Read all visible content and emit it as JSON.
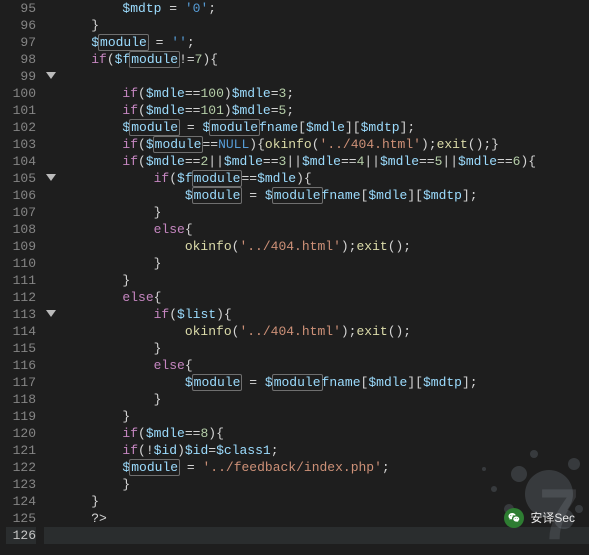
{
  "line_start": 95,
  "line_end": 126,
  "current_line": 126,
  "fold_lines": [
    99,
    105,
    113
  ],
  "highlight_word": "module",
  "lines": [
    {
      "n": 95,
      "indent": 8,
      "tokens": [
        {
          "t": "var",
          "v": "$mdtp"
        },
        {
          "t": "punc",
          "v": " "
        },
        {
          "t": "op",
          "v": "="
        },
        {
          "t": "punc",
          "v": " "
        },
        {
          "t": "dstr",
          "v": "'0'"
        },
        {
          "t": "punc",
          "v": ";"
        }
      ]
    },
    {
      "n": 96,
      "indent": 4,
      "tokens": [
        {
          "t": "punc",
          "v": "}"
        }
      ]
    },
    {
      "n": 97,
      "indent": 4,
      "tokens": [
        {
          "t": "var",
          "v": "$"
        },
        {
          "t": "var-hl",
          "v": "module"
        },
        {
          "t": "punc",
          "v": " "
        },
        {
          "t": "op",
          "v": "="
        },
        {
          "t": "punc",
          "v": " "
        },
        {
          "t": "dstr",
          "v": "''"
        },
        {
          "t": "punc",
          "v": ";"
        }
      ]
    },
    {
      "n": 98,
      "indent": 4,
      "tokens": [
        {
          "t": "kw",
          "v": "if"
        },
        {
          "t": "punc",
          "v": "("
        },
        {
          "t": "var",
          "v": "$f"
        },
        {
          "t": "var-hl",
          "v": "module"
        },
        {
          "t": "op",
          "v": "!="
        },
        {
          "t": "num",
          "v": "7"
        },
        {
          "t": "punc",
          "v": "){"
        }
      ]
    },
    {
      "n": 99,
      "indent": 0,
      "tokens": []
    },
    {
      "n": 100,
      "indent": 8,
      "tokens": [
        {
          "t": "kw",
          "v": "if"
        },
        {
          "t": "punc",
          "v": "("
        },
        {
          "t": "var",
          "v": "$mdle"
        },
        {
          "t": "op",
          "v": "=="
        },
        {
          "t": "num",
          "v": "100"
        },
        {
          "t": "punc",
          "v": ")"
        },
        {
          "t": "var",
          "v": "$mdle"
        },
        {
          "t": "op",
          "v": "="
        },
        {
          "t": "num",
          "v": "3"
        },
        {
          "t": "punc",
          "v": ";"
        }
      ]
    },
    {
      "n": 101,
      "indent": 8,
      "tokens": [
        {
          "t": "kw",
          "v": "if"
        },
        {
          "t": "punc",
          "v": "("
        },
        {
          "t": "var",
          "v": "$mdle"
        },
        {
          "t": "op",
          "v": "=="
        },
        {
          "t": "num",
          "v": "101"
        },
        {
          "t": "punc",
          "v": ")"
        },
        {
          "t": "var",
          "v": "$mdle"
        },
        {
          "t": "op",
          "v": "="
        },
        {
          "t": "num",
          "v": "5"
        },
        {
          "t": "punc",
          "v": ";"
        }
      ]
    },
    {
      "n": 102,
      "indent": 8,
      "tokens": [
        {
          "t": "var",
          "v": "$"
        },
        {
          "t": "var-hl",
          "v": "module"
        },
        {
          "t": "punc",
          "v": " "
        },
        {
          "t": "op",
          "v": "="
        },
        {
          "t": "punc",
          "v": " "
        },
        {
          "t": "var",
          "v": "$"
        },
        {
          "t": "var-hl",
          "v": "module"
        },
        {
          "t": "var",
          "v": "fname"
        },
        {
          "t": "punc",
          "v": "["
        },
        {
          "t": "var",
          "v": "$mdle"
        },
        {
          "t": "punc",
          "v": "]["
        },
        {
          "t": "var",
          "v": "$mdtp"
        },
        {
          "t": "punc",
          "v": "];"
        }
      ]
    },
    {
      "n": 103,
      "indent": 8,
      "tokens": [
        {
          "t": "kw",
          "v": "if"
        },
        {
          "t": "punc",
          "v": "("
        },
        {
          "t": "var",
          "v": "$"
        },
        {
          "t": "var-hl",
          "v": "module"
        },
        {
          "t": "op",
          "v": "=="
        },
        {
          "t": "const",
          "v": "NULL"
        },
        {
          "t": "punc",
          "v": "){"
        },
        {
          "t": "fn",
          "v": "okinfo"
        },
        {
          "t": "punc",
          "v": "("
        },
        {
          "t": "str",
          "v": "'../404.html'"
        },
        {
          "t": "punc",
          "v": ");"
        },
        {
          "t": "fn",
          "v": "exit"
        },
        {
          "t": "punc",
          "v": "();}"
        }
      ]
    },
    {
      "n": 104,
      "indent": 8,
      "tokens": [
        {
          "t": "kw",
          "v": "if"
        },
        {
          "t": "punc",
          "v": "("
        },
        {
          "t": "var",
          "v": "$mdle"
        },
        {
          "t": "op",
          "v": "=="
        },
        {
          "t": "num",
          "v": "2"
        },
        {
          "t": "op",
          "v": "||"
        },
        {
          "t": "var",
          "v": "$mdle"
        },
        {
          "t": "op",
          "v": "=="
        },
        {
          "t": "num",
          "v": "3"
        },
        {
          "t": "op",
          "v": "||"
        },
        {
          "t": "var",
          "v": "$mdle"
        },
        {
          "t": "op",
          "v": "=="
        },
        {
          "t": "num",
          "v": "4"
        },
        {
          "t": "op",
          "v": "||"
        },
        {
          "t": "var",
          "v": "$mdle"
        },
        {
          "t": "op",
          "v": "=="
        },
        {
          "t": "num",
          "v": "5"
        },
        {
          "t": "op",
          "v": "||"
        },
        {
          "t": "var",
          "v": "$mdle"
        },
        {
          "t": "op",
          "v": "=="
        },
        {
          "t": "num",
          "v": "6"
        },
        {
          "t": "punc",
          "v": "){"
        }
      ]
    },
    {
      "n": 105,
      "indent": 12,
      "tokens": [
        {
          "t": "kw",
          "v": "if"
        },
        {
          "t": "punc",
          "v": "("
        },
        {
          "t": "var",
          "v": "$f"
        },
        {
          "t": "var-hl",
          "v": "module"
        },
        {
          "t": "op",
          "v": "=="
        },
        {
          "t": "var",
          "v": "$mdle"
        },
        {
          "t": "punc",
          "v": "){"
        }
      ]
    },
    {
      "n": 106,
      "indent": 16,
      "tokens": [
        {
          "t": "var",
          "v": "$"
        },
        {
          "t": "var-hl",
          "v": "module"
        },
        {
          "t": "punc",
          "v": " "
        },
        {
          "t": "op",
          "v": "="
        },
        {
          "t": "punc",
          "v": " "
        },
        {
          "t": "var",
          "v": "$"
        },
        {
          "t": "var-hl",
          "v": "module"
        },
        {
          "t": "var",
          "v": "fname"
        },
        {
          "t": "punc",
          "v": "["
        },
        {
          "t": "var",
          "v": "$mdle"
        },
        {
          "t": "punc",
          "v": "]["
        },
        {
          "t": "var",
          "v": "$mdtp"
        },
        {
          "t": "punc",
          "v": "];"
        }
      ]
    },
    {
      "n": 107,
      "indent": 12,
      "tokens": [
        {
          "t": "punc",
          "v": "}"
        }
      ]
    },
    {
      "n": 108,
      "indent": 12,
      "tokens": [
        {
          "t": "kw",
          "v": "else"
        },
        {
          "t": "punc",
          "v": "{"
        }
      ]
    },
    {
      "n": 109,
      "indent": 16,
      "tokens": [
        {
          "t": "fn",
          "v": "okinfo"
        },
        {
          "t": "punc",
          "v": "("
        },
        {
          "t": "str",
          "v": "'../404.html'"
        },
        {
          "t": "punc",
          "v": ");"
        },
        {
          "t": "fn",
          "v": "exit"
        },
        {
          "t": "punc",
          "v": "();"
        }
      ]
    },
    {
      "n": 110,
      "indent": 12,
      "tokens": [
        {
          "t": "punc",
          "v": "}"
        }
      ]
    },
    {
      "n": 111,
      "indent": 8,
      "tokens": [
        {
          "t": "punc",
          "v": "}"
        }
      ]
    },
    {
      "n": 112,
      "indent": 8,
      "tokens": [
        {
          "t": "kw",
          "v": "else"
        },
        {
          "t": "punc",
          "v": "{"
        }
      ]
    },
    {
      "n": 113,
      "indent": 12,
      "tokens": [
        {
          "t": "kw",
          "v": "if"
        },
        {
          "t": "punc",
          "v": "("
        },
        {
          "t": "var",
          "v": "$list"
        },
        {
          "t": "punc",
          "v": "){"
        }
      ]
    },
    {
      "n": 114,
      "indent": 16,
      "tokens": [
        {
          "t": "fn",
          "v": "okinfo"
        },
        {
          "t": "punc",
          "v": "("
        },
        {
          "t": "str",
          "v": "'../404.html'"
        },
        {
          "t": "punc",
          "v": ");"
        },
        {
          "t": "fn",
          "v": "exit"
        },
        {
          "t": "punc",
          "v": "();"
        }
      ]
    },
    {
      "n": 115,
      "indent": 12,
      "tokens": [
        {
          "t": "punc",
          "v": "}"
        }
      ]
    },
    {
      "n": 116,
      "indent": 12,
      "tokens": [
        {
          "t": "kw",
          "v": "else"
        },
        {
          "t": "punc",
          "v": "{"
        }
      ]
    },
    {
      "n": 117,
      "indent": 16,
      "tokens": [
        {
          "t": "var",
          "v": "$"
        },
        {
          "t": "var-hl",
          "v": "module"
        },
        {
          "t": "punc",
          "v": " "
        },
        {
          "t": "op",
          "v": "="
        },
        {
          "t": "punc",
          "v": " "
        },
        {
          "t": "var",
          "v": "$"
        },
        {
          "t": "var-hl",
          "v": "module"
        },
        {
          "t": "var",
          "v": "fname"
        },
        {
          "t": "punc",
          "v": "["
        },
        {
          "t": "var",
          "v": "$mdle"
        },
        {
          "t": "punc",
          "v": "]["
        },
        {
          "t": "var",
          "v": "$mdtp"
        },
        {
          "t": "punc",
          "v": "];"
        }
      ]
    },
    {
      "n": 118,
      "indent": 12,
      "tokens": [
        {
          "t": "punc",
          "v": "}"
        }
      ]
    },
    {
      "n": 119,
      "indent": 8,
      "tokens": [
        {
          "t": "punc",
          "v": "}"
        }
      ]
    },
    {
      "n": 120,
      "indent": 8,
      "tokens": [
        {
          "t": "kw",
          "v": "if"
        },
        {
          "t": "punc",
          "v": "("
        },
        {
          "t": "var",
          "v": "$mdle"
        },
        {
          "t": "op",
          "v": "=="
        },
        {
          "t": "num",
          "v": "8"
        },
        {
          "t": "punc",
          "v": "){"
        }
      ]
    },
    {
      "n": 121,
      "indent": 8,
      "tokens": [
        {
          "t": "kw",
          "v": "if"
        },
        {
          "t": "punc",
          "v": "("
        },
        {
          "t": "op",
          "v": "!"
        },
        {
          "t": "var",
          "v": "$id"
        },
        {
          "t": "punc",
          "v": ")"
        },
        {
          "t": "var",
          "v": "$id"
        },
        {
          "t": "op",
          "v": "="
        },
        {
          "t": "var",
          "v": "$class1"
        },
        {
          "t": "punc",
          "v": ";"
        }
      ]
    },
    {
      "n": 122,
      "indent": 8,
      "tokens": [
        {
          "t": "var",
          "v": "$"
        },
        {
          "t": "var-hl",
          "v": "module"
        },
        {
          "t": "punc",
          "v": " "
        },
        {
          "t": "op",
          "v": "="
        },
        {
          "t": "punc",
          "v": " "
        },
        {
          "t": "str",
          "v": "'../feedback/index.php'"
        },
        {
          "t": "punc",
          "v": ";"
        }
      ]
    },
    {
      "n": 123,
      "indent": 8,
      "tokens": [
        {
          "t": "punc",
          "v": "}"
        }
      ]
    },
    {
      "n": 124,
      "indent": 4,
      "tokens": [
        {
          "t": "punc",
          "v": "}"
        }
      ]
    },
    {
      "n": 125,
      "indent": 4,
      "tokens": [
        {
          "t": "punc",
          "v": "?>"
        }
      ]
    }
  ],
  "watermark_text": "7",
  "footer_label": "安译Sec"
}
